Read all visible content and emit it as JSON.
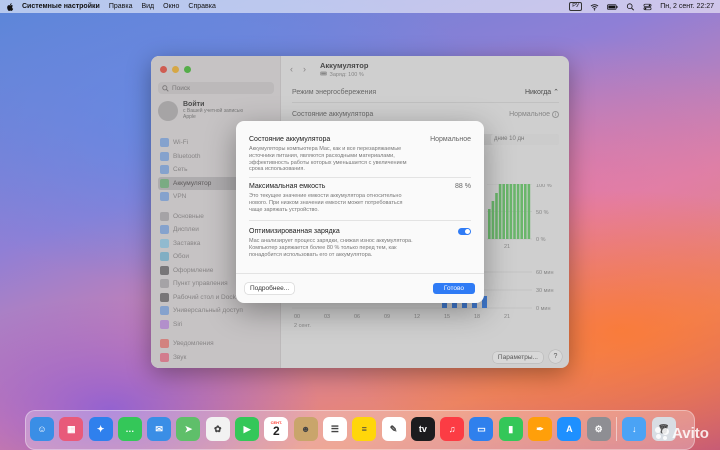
{
  "menubar": {
    "app_name": "Системные настройки",
    "items": [
      "Правка",
      "Вид",
      "Окно",
      "Справка"
    ],
    "input_source": "РУ",
    "datetime": "Пн, 2 сент.  22:27"
  },
  "sidebar": {
    "search_placeholder": "Поиск",
    "signin_title": "Войти",
    "signin_subtitle": "с Вашей учетной записью Apple",
    "items": [
      {
        "label": "Wi‑Fi",
        "color": "#3d8bf7"
      },
      {
        "label": "Bluetooth",
        "color": "#3d8bf7"
      },
      {
        "label": "Сеть",
        "color": "#3d8bf7"
      },
      {
        "label": "Аккумулятор",
        "color": "#43c35a"
      },
      {
        "label": "VPN",
        "color": "#3d8bf7"
      },
      {
        "label": "Основные",
        "color": "#8e8e93"
      },
      {
        "label": "Дисплеи",
        "color": "#3d8bf7"
      },
      {
        "label": "Заставка",
        "color": "#5ac8fa"
      },
      {
        "label": "Обои",
        "color": "#34aadc"
      },
      {
        "label": "Оформление",
        "color": "#1c1c1e"
      },
      {
        "label": "Пункт управления",
        "color": "#8e8e93"
      },
      {
        "label": "Рабочий стол и Dock",
        "color": "#1c1c1e"
      },
      {
        "label": "Универсальный доступ",
        "color": "#3d8bf7"
      },
      {
        "label": "Siri",
        "color": "#b05cf0"
      },
      {
        "label": "Уведомления",
        "color": "#ff3b30"
      },
      {
        "label": "Звук",
        "color": "#ff2d55"
      }
    ]
  },
  "main": {
    "title": "Аккумулятор",
    "subtitle": "Заряд: 100 %",
    "rows": [
      {
        "label": "Режим энергосбережения",
        "value": "Никогда"
      },
      {
        "label": "Состояние аккумулятора",
        "value": "Нормальное"
      }
    ],
    "tab_fragment": "дние 10 дн",
    "chart_y_labels": [
      "100 %",
      "50 %",
      "0 %"
    ],
    "chart_x_label": "21",
    "usage_y_labels": [
      "60 мин",
      "30 мин",
      "0 мин"
    ],
    "usage_x_labels": [
      "00",
      "03",
      "06",
      "09",
      "12",
      "15",
      "18",
      "21"
    ],
    "date_label": "2 сент.",
    "params_button": "Параметры...",
    "help_button": "?"
  },
  "modal": {
    "sections": [
      {
        "title": "Состояние аккумулятора",
        "value": "Нормальное",
        "description": "Аккумуляторы компьютера Mac, как и все перезаряжаемые источники питания, являются расходными материалами, эффективность работы которых уменьшается с увеличением срока использования."
      },
      {
        "title": "Максимальная емкость",
        "value": "88 %",
        "description": "Это текущее значение емкости аккумулятора относительно нового. При низком значении емкости может потребоваться чаще заряжать устройство."
      },
      {
        "title": "Оптимизированная зарядка",
        "toggle_on": true,
        "description": "Mac анализирует процесс зарядки, снижая износ аккумулятора. Компьютер заряжается более 80 % только перед тем, как понадобится использовать его от аккумулятора."
      }
    ],
    "more_button": "Подробнее...",
    "done_button": "Готово"
  },
  "dock": {
    "apps": [
      {
        "name": "Finder",
        "glyph": "☺",
        "color": "#3a8ee6"
      },
      {
        "name": "Launchpad",
        "glyph": "▦",
        "color": "#e85a7a"
      },
      {
        "name": "Safari",
        "glyph": "✦",
        "color": "#2f80ed"
      },
      {
        "name": "Messages",
        "glyph": "…",
        "color": "#34c759"
      },
      {
        "name": "Mail",
        "glyph": "✉",
        "color": "#3a8ee6"
      },
      {
        "name": "Maps",
        "glyph": "➤",
        "color": "#5fbf6a"
      },
      {
        "name": "Photos",
        "glyph": "✿",
        "color": "#f2f2f2"
      },
      {
        "name": "FaceTime",
        "glyph": "▶",
        "color": "#34c759"
      },
      {
        "name": "Calendar",
        "glyph": "2",
        "color": "#ffffff"
      },
      {
        "name": "Contacts",
        "glyph": "☻",
        "color": "#c9a56b"
      },
      {
        "name": "Reminders",
        "glyph": "☰",
        "color": "#ffffff"
      },
      {
        "name": "Notes",
        "glyph": "≡",
        "color": "#ffd60a"
      },
      {
        "name": "Freeform",
        "glyph": "✎",
        "color": "#ffffff"
      },
      {
        "name": "TV",
        "glyph": "tv",
        "color": "#1c1c1e"
      },
      {
        "name": "Music",
        "glyph": "♫",
        "color": "#fc3c44"
      },
      {
        "name": "Keynote",
        "glyph": "▭",
        "color": "#2f80ed"
      },
      {
        "name": "Numbers",
        "glyph": "▮",
        "color": "#34c759"
      },
      {
        "name": "Pages",
        "glyph": "✒",
        "color": "#ff9f0a"
      },
      {
        "name": "App Store",
        "glyph": "A",
        "color": "#1e90ff"
      },
      {
        "name": "System Settings",
        "glyph": "⚙",
        "color": "#8e8e93"
      },
      {
        "name": "Downloads",
        "glyph": "↓",
        "color": "#4aa3f5"
      },
      {
        "name": "Trash",
        "glyph": "🗑",
        "color": "#d8dde3"
      }
    ],
    "calendar_month": "СЕНТ.",
    "calendar_day": "2"
  },
  "watermark": "Avito"
}
